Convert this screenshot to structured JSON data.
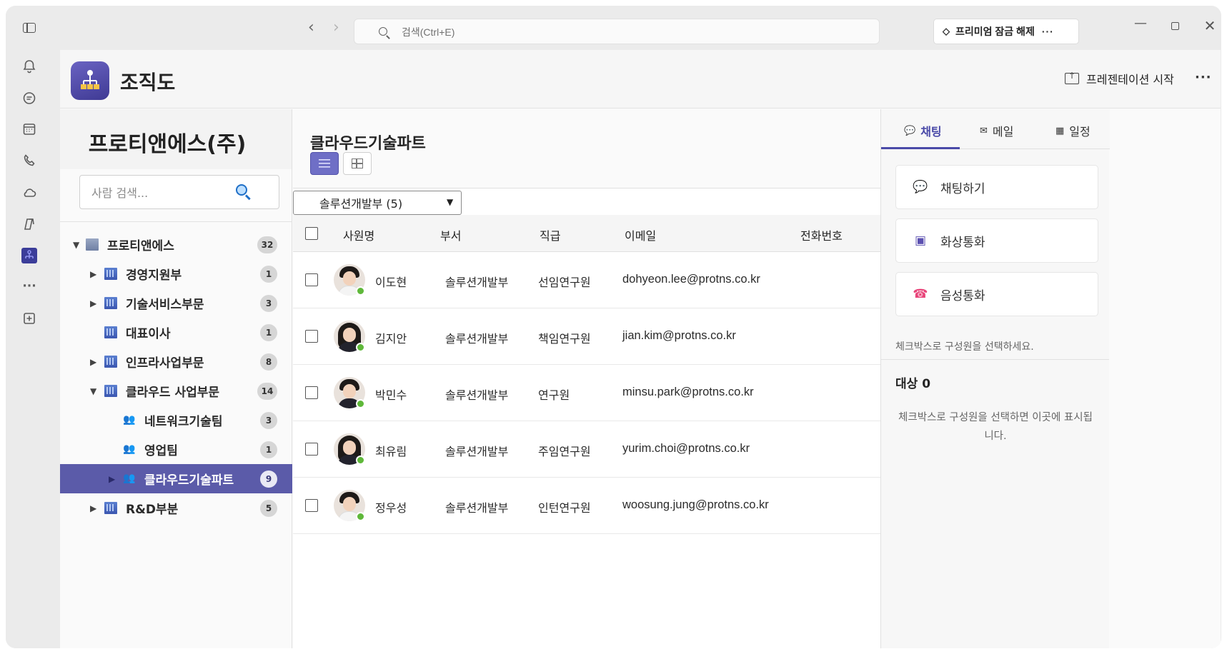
{
  "titlebar": {
    "search_placeholder": "검색(Ctrl+E)",
    "premium_label": "프리미엄 잠금 해제",
    "premium_more": "···"
  },
  "rail": {
    "items": [
      "bell-icon",
      "chat-icon",
      "calendar-icon",
      "phone-icon",
      "cloud-icon",
      "copilot-icon",
      "org-chart-app-icon",
      "more-icon",
      "add-app-icon"
    ],
    "more_glyph": "···"
  },
  "header": {
    "title": "조직도",
    "present_label": "프레젠테이션 시작",
    "more_glyph": "···"
  },
  "tree": {
    "company_title": "프로티앤에스(주)",
    "search_placeholder": "사람 검색...",
    "nodes": [
      {
        "label": "프로티앤에스",
        "count": "32",
        "caret": "▼",
        "level": 0,
        "icon": "building-gray"
      },
      {
        "label": "경영지원부",
        "count": "1",
        "caret": "▶",
        "level": 1,
        "icon": "building"
      },
      {
        "label": "기술서비스부문",
        "count": "3",
        "caret": "▶",
        "level": 1,
        "icon": "building"
      },
      {
        "label": "대표이사",
        "count": "1",
        "caret": "",
        "level": 1,
        "icon": "building"
      },
      {
        "label": "인프라사업부문",
        "count": "8",
        "caret": "▶",
        "level": 1,
        "icon": "building"
      },
      {
        "label": "클라우드 사업부문",
        "count": "14",
        "caret": "▼",
        "level": 1,
        "icon": "building"
      },
      {
        "label": "네트워크기술팀",
        "count": "3",
        "caret": "",
        "level": 2,
        "icon": "team"
      },
      {
        "label": "영업팀",
        "count": "1",
        "caret": "",
        "level": 2,
        "icon": "team"
      },
      {
        "label": "클라우드기술파트",
        "count": "9",
        "caret": "▶",
        "level": 2,
        "icon": "team",
        "selected": true
      },
      {
        "label": "R&D부분",
        "count": "5",
        "caret": "▶",
        "level": 1,
        "icon": "building"
      }
    ]
  },
  "center": {
    "title": "클라우드기술파트",
    "dept_select": "솔루션개발부 (5)",
    "columns": [
      "사원명",
      "부서",
      "직급",
      "이메일",
      "전화번호"
    ],
    "rows": [
      {
        "name": "이도현",
        "dept": "솔루션개발부",
        "rank": "선임연구원",
        "email": "dohyeon.lee@protns.co.kr",
        "phone": "",
        "avatar": "male-white-shirt"
      },
      {
        "name": "김지안",
        "dept": "솔루션개발부",
        "rank": "책임연구원",
        "email": "jian.kim@protns.co.kr",
        "phone": "",
        "avatar": "female"
      },
      {
        "name": "박민수",
        "dept": "솔루션개발부",
        "rank": "연구원",
        "email": "minsu.park@protns.co.kr",
        "phone": "",
        "avatar": "male"
      },
      {
        "name": "최유림",
        "dept": "솔루션개발부",
        "rank": "주임연구원",
        "email": "yurim.choi@protns.co.kr",
        "phone": "",
        "avatar": "female"
      },
      {
        "name": "정우성",
        "dept": "솔루션개발부",
        "rank": "인턴연구원",
        "email": "woosung.jung@protns.co.kr",
        "phone": "",
        "avatar": "male-white-shirt"
      }
    ]
  },
  "right": {
    "tabs": [
      {
        "label": "채팅",
        "icon": "chat-bubble-icon",
        "active": true
      },
      {
        "label": "메일",
        "icon": "mail-icon",
        "active": false
      },
      {
        "label": "일정",
        "icon": "calendar-icon",
        "active": false
      }
    ],
    "actions": [
      {
        "label": "채팅하기",
        "icon": "chat-bubble-icon"
      },
      {
        "label": "화상통화",
        "icon": "video-call-icon"
      },
      {
        "label": "음성통화",
        "icon": "phone-icon"
      }
    ],
    "hint": "체크박스로 구성원을 선택하세요.",
    "target_label": "대상 0",
    "empty_hint": "체크박스로 구성원을 선택하면 이곳에 표시됩니다."
  },
  "colors": {
    "accent": "#5b5ba9",
    "presence_online": "#5fb83a",
    "tab_active": "#4a4aa8"
  }
}
